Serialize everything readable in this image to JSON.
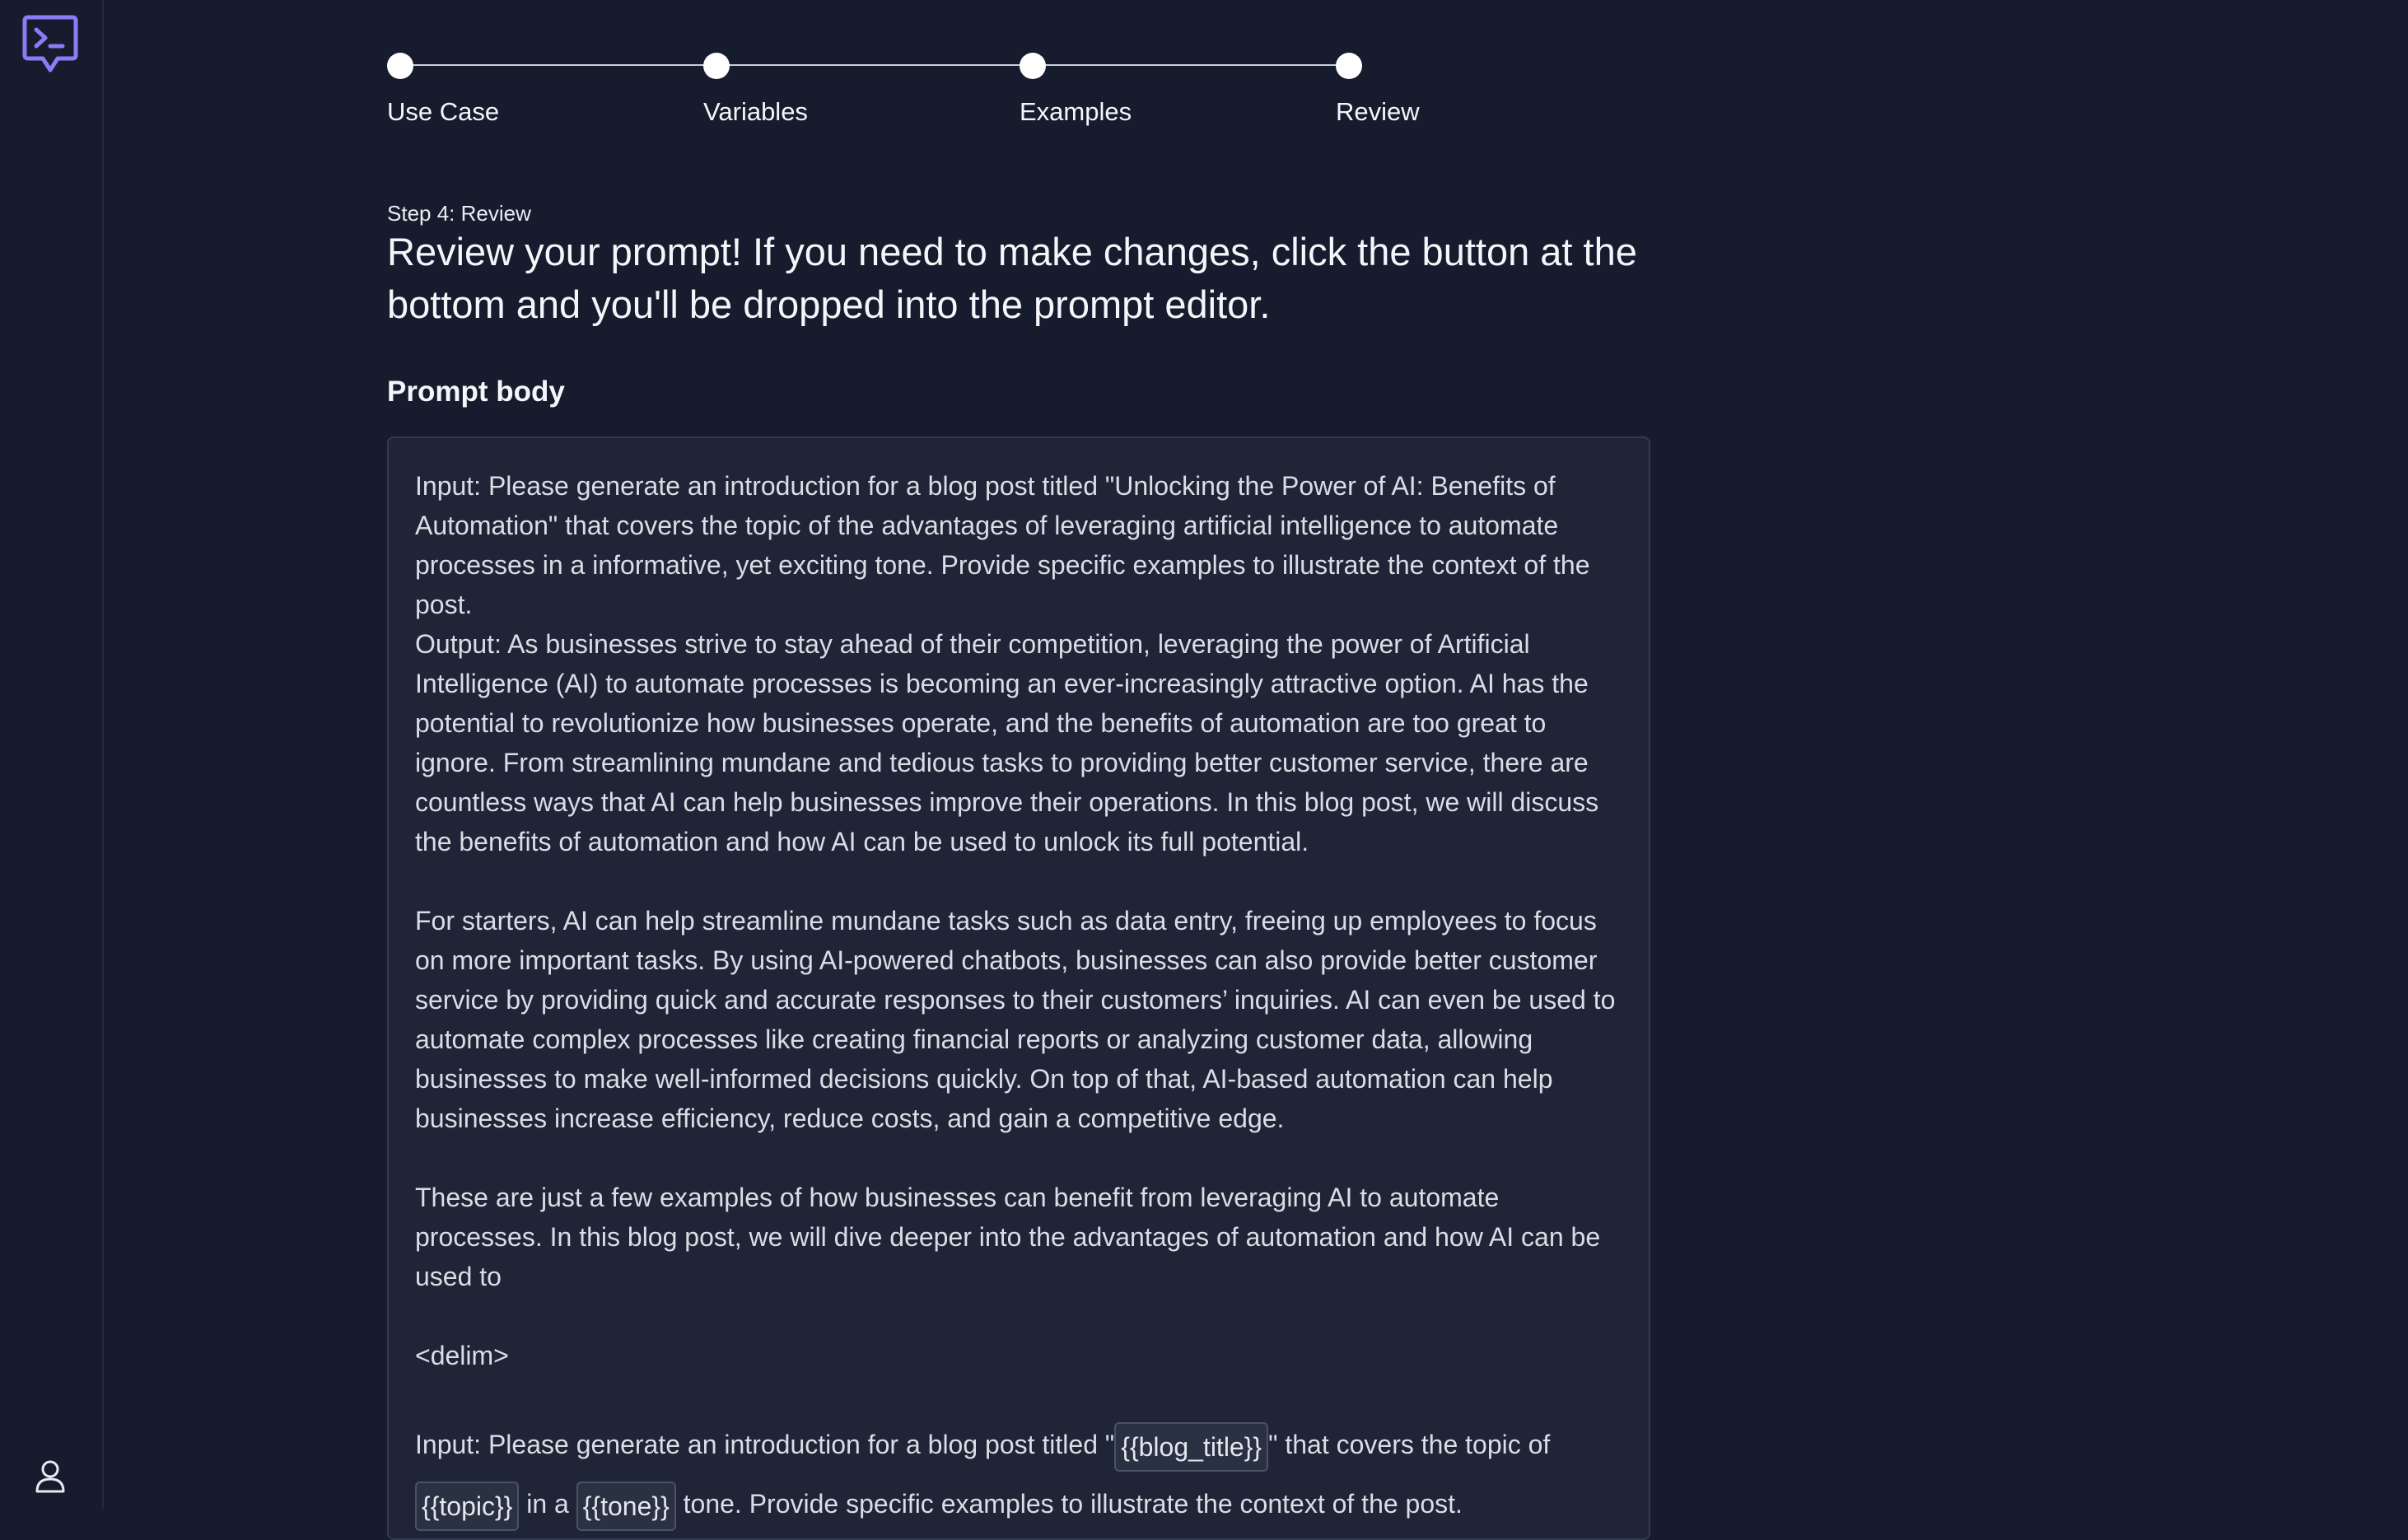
{
  "sidebar": {
    "logo_icon": "chat-terminal-icon",
    "user_icon": "user-icon"
  },
  "stepper": {
    "steps": [
      {
        "label": "Use Case"
      },
      {
        "label": "Variables"
      },
      {
        "label": "Examples"
      },
      {
        "label": "Review"
      }
    ]
  },
  "page": {
    "step_label": "Step 4: Review",
    "heading": "Review your prompt! If you need to make changes, click the button at the bottom and you'll be dropped into the prompt editor.",
    "section_title": "Prompt body"
  },
  "prompt": {
    "p1": "Input: Please generate an introduction for a blog post titled \"Unlocking the Power of AI: Benefits of Automation\" that covers the topic of the advantages of leveraging artificial intelligence to automate processes in a informative, yet exciting tone. Provide specific examples to illustrate the context of the post.",
    "p2": "Output: As businesses strive to stay ahead of their competition, leveraging the power of Artificial Intelligence (AI) to automate processes is becoming an ever-increasingly attractive option. AI has the potential to revolutionize how businesses operate, and the benefits of automation are too great to ignore. From streamlining mundane and tedious tasks to providing better customer service, there are countless ways that AI can help businesses improve their operations. In this blog post, we will discuss the benefits of automation and how AI can be used to unlock its full potential.",
    "p3": "For starters, AI can help streamline mundane tasks such as data entry, freeing up employees to focus on more important tasks. By using AI-powered chatbots, businesses can also provide better customer service by providing quick and accurate responses to their customers’ inquiries. AI can even be used to automate complex processes like creating financial reports or analyzing customer data, allowing businesses to make well-informed decisions quickly. On top of that, AI-based automation can help businesses increase efficiency, reduce costs, and gain a competitive edge.",
    "p4": "These are just a few examples of how businesses can benefit from leveraging AI to automate processes. In this blog post, we will dive deeper into the advantages of automation and how AI can be used to",
    "delim": "<delim>",
    "template": {
      "part1": "Input: Please generate an introduction for a blog post titled \"",
      "var_blog_title": "{{blog_title}}",
      "part2": "\" that covers the topic of ",
      "var_topic": "{{topic}}",
      "part3": " in a ",
      "var_tone": "{{tone}}",
      "part4": " tone. Provide specific examples to illustrate the context of the post."
    }
  },
  "colors": {
    "background": "#161c2d",
    "panel": "#1f2536",
    "accent": "#8b7cf6"
  }
}
